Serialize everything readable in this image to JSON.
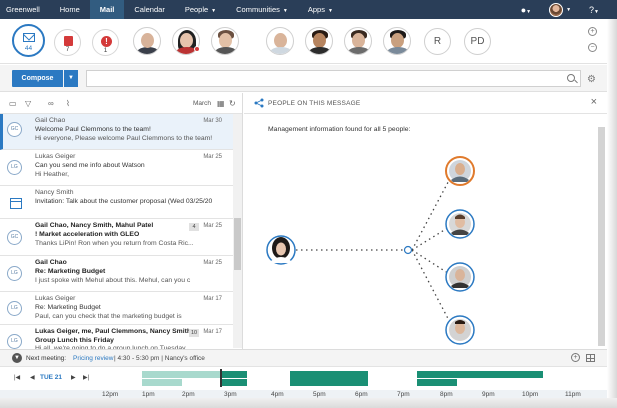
{
  "nav": {
    "brand": "Greenwell",
    "items": [
      "Home",
      "Mail",
      "Calendar",
      "People",
      "Communities",
      "Apps"
    ],
    "active": "Mail",
    "help": "?"
  },
  "badges": {
    "mail_count": "44",
    "calendar_count": "7",
    "alerts_count": "1"
  },
  "people_bar": {
    "initials": [
      "R",
      "PD"
    ]
  },
  "compose": {
    "label": "Compose",
    "search_placeholder": ""
  },
  "list": {
    "month": "March",
    "messages": [
      {
        "avatar": "GC",
        "from": "Gail Chao",
        "subject": "Welcome Paul Clemmons to the team!",
        "snippet": "Hi everyone, Please welcome Paul Clemmons to the team!",
        "date": "Mar 30",
        "selected": true
      },
      {
        "avatar": "LG",
        "from": "Lukas Geiger",
        "subject": "Can you send me info about Watson",
        "snippet": "Hi Heather,",
        "date": "Mar 25"
      },
      {
        "avatar": "cal",
        "from": "Nancy Smith",
        "subject": "Invitation: Talk about the customer proposal (Wed 03/25/20",
        "snippet": "",
        "date": ""
      },
      {
        "avatar": "GC",
        "from": "Gail Chao, Nancy Smith, Mahul Patel",
        "subject": "! Market acceleration with GLEO",
        "snippet": "Thanks LiPin! Ron when you return from Costa Ric...",
        "date": "Mar 25",
        "count": "4"
      },
      {
        "avatar": "LG",
        "from": "Gail Chao",
        "subject": "Re: Marketing Budget",
        "snippet": "I just spoke with Mehul about this. Mehul, can you c",
        "date": "Mar 25"
      },
      {
        "avatar": "LG",
        "from": "Lukas Geiger",
        "subject": "Re: Marketing Budget",
        "snippet": "Paul, can you check that the marketing budget is",
        "date": "Mar 17"
      },
      {
        "avatar": "LG",
        "from": "Lukas Geiger, me, Paul Clemmons, Nancy Smith",
        "subject": "Group Lunch this Friday",
        "snippet": "Hi all, we're going to do a group lunch on Tuesday...",
        "date": "Mar 17",
        "count": "10"
      }
    ]
  },
  "people_pane": {
    "title": "PEOPLE ON THIS MESSAGE",
    "message": "Management information found for all 5 people:"
  },
  "next_meeting": {
    "label": "Next meeting:",
    "title": "Pricing review",
    "time": "4:30 - 5:30 pm",
    "location": "Nancy's office",
    "separator": "|"
  },
  "timeline": {
    "date": "TUE 21",
    "hours": [
      "12pm",
      "1pm",
      "2pm",
      "3pm",
      "4pm",
      "5pm",
      "6pm",
      "7pm",
      "8pm",
      "9pm",
      "10pm",
      "11pm"
    ]
  },
  "colors": {
    "nav_bg": "#2a3e58",
    "accent": "#2b79c2",
    "timeline_busy": "#1a8f74",
    "alert": "#d43a3a"
  }
}
